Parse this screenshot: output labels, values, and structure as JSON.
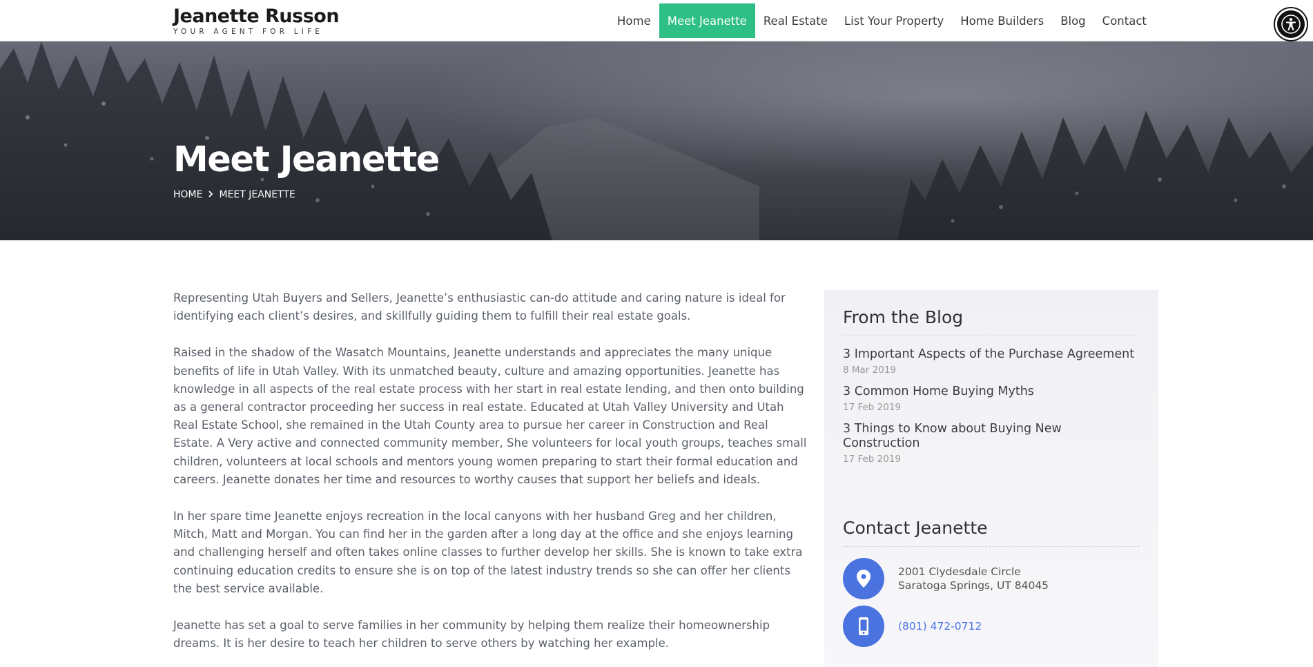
{
  "header": {
    "logo_name": "Jeanette Russon",
    "logo_tagline": "YOUR AGENT FOR LIFE",
    "nav": [
      {
        "label": "Home"
      },
      {
        "label": "Meet Jeanette",
        "active": true
      },
      {
        "label": "Real Estate"
      },
      {
        "label": "List Your Property"
      },
      {
        "label": "Home Builders"
      },
      {
        "label": "Blog"
      },
      {
        "label": "Contact"
      }
    ],
    "accessibility_icon": "accessibility-icon"
  },
  "hero": {
    "title": "Meet Jeanette",
    "breadcrumb": [
      "HOME",
      "MEET JEANETTE"
    ],
    "breadcrumb_separator_icon": "chevron-right-icon"
  },
  "content": {
    "paragraphs": [
      "Representing Utah Buyers and Sellers, Jeanette’s enthusiastic can-do attitude and caring nature is ideal for identifying each client’s desires, and skillfully guiding them to fulfill their real estate goals.",
      "Raised in the shadow of the Wasatch Mountains, Jeanette understands and appreciates the many unique benefits of life in Utah Valley. With its unmatched beauty, culture and amazing opportunities. Jeanette has knowledge in all aspects of the real estate process with her start in real estate lending, and then onto building as a general contractor proceeding her success in real estate. Educated at Utah Valley University and Utah Real Estate School, she remained in the Utah County area to pursue her career in Construction and Real Estate. A Very active and connected community member, She volunteers for local youth groups, teaches small children, volunteers at local schools and mentors young women preparing to start their formal education and careers. Jeanette donates her time and resources to worthy causes that support her beliefs and ideals.",
      "In her spare time Jeanette enjoys recreation in the local canyons with her husband Greg and her children, Mitch, Matt and Morgan. You can find her in the garden after a long day at the office and she enjoys learning and challenging herself and often takes online classes to further develop her skills. She is known to take extra continuing education credits to ensure she is on top of the latest industry trends so she can offer her clients the best service available.",
      "Jeanette has set a goal to serve families in her community by helping them realize their homeownership dreams. It is her desire to teach her children to serve others by watching her example."
    ]
  },
  "sidebar": {
    "blog_title": "From the Blog",
    "posts": [
      {
        "title": "3 Important Aspects of the Purchase Agreement",
        "date": "8 Mar 2019"
      },
      {
        "title": "3 Common Home Buying Myths",
        "date": "17 Feb 2019"
      },
      {
        "title": "3 Things to Know about Buying New Construction",
        "date": "17 Feb 2019"
      }
    ],
    "contact_title": "Contact Jeanette",
    "address_line1": "2001 Clydesdale Circle",
    "address_line2": "Saratoga Springs, UT 84045",
    "phone": "(801) 472-0712",
    "address_icon": "map-pin-icon",
    "phone_icon": "mobile-phone-icon"
  },
  "colors": {
    "accent_green": "#2dbf85",
    "accent_blue": "#4b73e0"
  }
}
